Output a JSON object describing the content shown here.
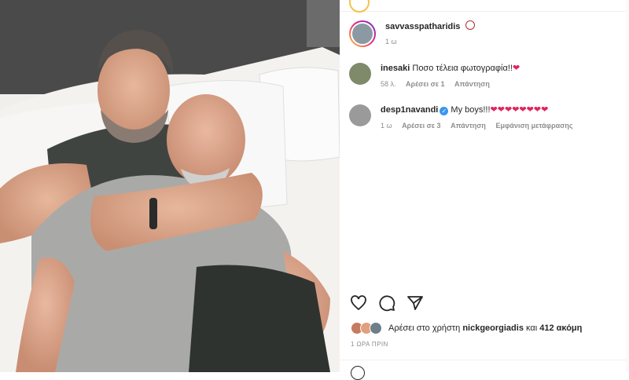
{
  "post": {
    "author": "savvasspatharidis",
    "author_time": "1 ω"
  },
  "comments": [
    {
      "username": "inesaki",
      "text": "Ποσο τέλεια φωτογραφία!!",
      "emoji": "❤",
      "time": "58 λ.",
      "likes": "Αρέσει σε 1",
      "reply": "Απάντηση",
      "translate": ""
    },
    {
      "username": "desp1navandi",
      "text": "My boys!!!",
      "emoji": "❤❤❤❤❤❤❤❤",
      "time": "1 ω",
      "likes": "Αρέσει σε 3",
      "reply": "Απάντηση",
      "translate": "Εμφάνιση μετάφρασης",
      "verified": true
    }
  ],
  "likes_line": {
    "prefix": "Αρέσει στο χρήστη",
    "user": "nickgeorgiadis",
    "joiner": "και",
    "more": "412 ακόμη"
  },
  "post_time": "1 ΩΡΑ ΠΡΙΝ",
  "icons": [
    "heart-icon",
    "comment-icon",
    "share-icon"
  ],
  "colors": {
    "heart": "#e0245e",
    "verified": "#3897f0",
    "muted": "#8e8e8e"
  }
}
